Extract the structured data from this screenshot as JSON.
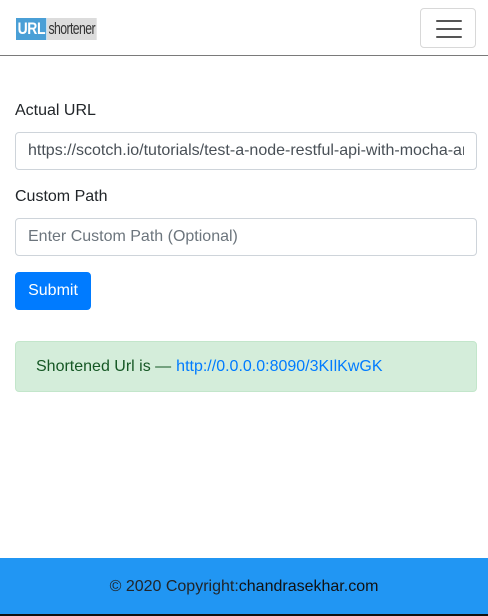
{
  "navbar": {
    "logo_url": "URL",
    "logo_shortener": "shortener",
    "toggler_icon": "hamburger-menu-icon"
  },
  "form": {
    "actual_url_label": "Actual URL",
    "actual_url_value": "https://scotch.io/tutorials/test-a-node-restful-api-with-mocha-and-chai",
    "custom_path_label": "Custom Path",
    "custom_path_placeholder": "Enter Custom Path (Optional)",
    "submit_label": "Submit"
  },
  "result": {
    "prefix": "Shortened Url is —",
    "short_url": "http://0.0.0.0:8090/3KIlKwGK"
  },
  "footer": {
    "copyright": "© 2020 Copyright:",
    "site": "chandrasekhar.com"
  },
  "colors": {
    "primary": "#007bff",
    "success_bg": "#d4edda",
    "success_text": "#155724",
    "footer_bg": "#2196f3"
  }
}
